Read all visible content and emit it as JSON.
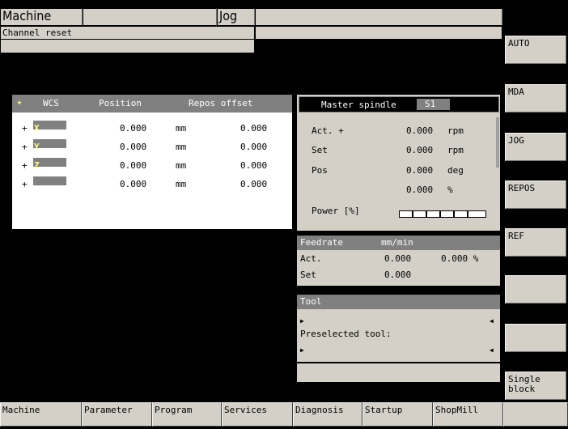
{
  "header": {
    "area": "Machine",
    "mode": "Jog",
    "channel_status": "Channel reset"
  },
  "wcs_table": {
    "headers": {
      "wcs": "WCS",
      "position": "Position",
      "repos": "Repos offset"
    },
    "rows": [
      {
        "sign": "+",
        "axis": "X",
        "position": "0.000",
        "unit": "mm",
        "repos": "0.000"
      },
      {
        "sign": "+",
        "axis": "Y",
        "position": "0.000",
        "unit": "mm",
        "repos": "0.000"
      },
      {
        "sign": "+",
        "axis": "Z",
        "position": "0.000",
        "unit": "mm",
        "repos": "0.000"
      },
      {
        "sign": "+",
        "axis": "",
        "position": "0.000",
        "unit": "mm",
        "repos": "0.000"
      }
    ]
  },
  "spindle": {
    "title": "Master spindle",
    "id": "S1",
    "act_label": "Act. +",
    "act_value": "0.000",
    "act_unit": "rpm",
    "set_label": "Set",
    "set_value": "0.000",
    "set_unit": "rpm",
    "pos_label": "Pos",
    "pos_value": "0.000",
    "pos_unit": "deg",
    "load_value": "0.000",
    "load_unit": "%",
    "power_label": "Power [%]",
    "power_level": 0
  },
  "feedrate": {
    "title": "Feedrate",
    "unit": "mm/min",
    "act_label": "Act.",
    "act_value": "0.000",
    "act_percent": "0.000 %",
    "set_label": "Set",
    "set_value": "0.000"
  },
  "tool": {
    "title": "Tool",
    "preselected_label": "Preselected tool:"
  },
  "vertical_softkeys": [
    "AUTO",
    "MDA",
    "JOG",
    "REPOS",
    "REF",
    "",
    "",
    "Single block"
  ],
  "horizontal_softkeys": [
    "Machine",
    "Parameter",
    "Program",
    "Services",
    "Diagnosis",
    "Startup",
    "ShopMill",
    ""
  ],
  "colors": {
    "panel": "#d4d0c8",
    "dark_bar": "#808080",
    "axis_letter": "#ffff80",
    "background": "#000000"
  }
}
